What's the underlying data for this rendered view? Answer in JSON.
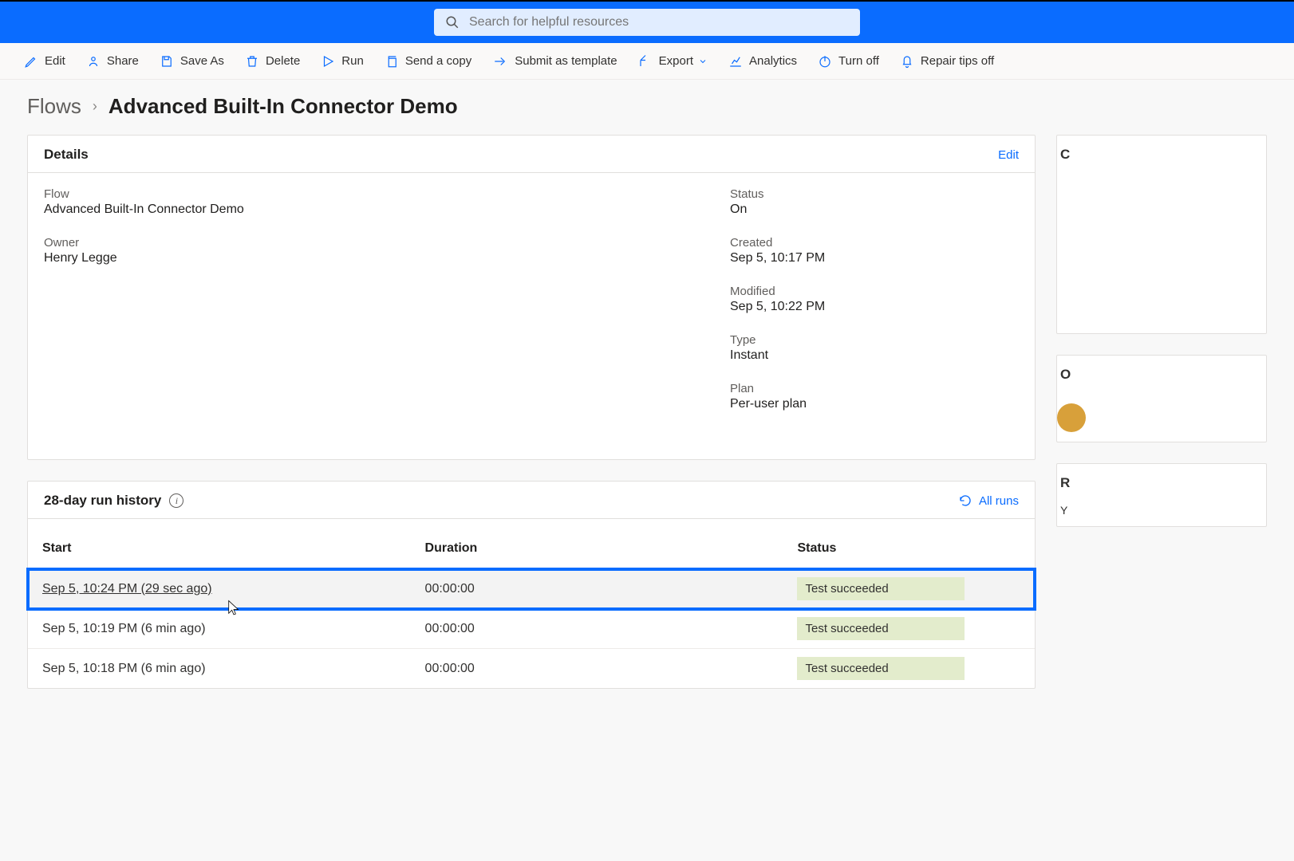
{
  "search": {
    "placeholder": "Search for helpful resources"
  },
  "toolbar": {
    "edit": "Edit",
    "share": "Share",
    "save_as": "Save As",
    "delete": "Delete",
    "run": "Run",
    "send_copy": "Send a copy",
    "submit_template": "Submit as template",
    "export": "Export",
    "analytics": "Analytics",
    "turn_off": "Turn off",
    "repair_tips": "Repair tips off"
  },
  "breadcrumb": {
    "root": "Flows",
    "title": "Advanced Built-In Connector Demo"
  },
  "details": {
    "header": "Details",
    "edit_link": "Edit",
    "flow_label": "Flow",
    "flow_value": "Advanced Built-In Connector Demo",
    "owner_label": "Owner",
    "owner_value": "Henry Legge",
    "status_label": "Status",
    "status_value": "On",
    "created_label": "Created",
    "created_value": "Sep 5, 10:17 PM",
    "modified_label": "Modified",
    "modified_value": "Sep 5, 10:22 PM",
    "type_label": "Type",
    "type_value": "Instant",
    "plan_label": "Plan",
    "plan_value": "Per-user plan"
  },
  "run_history": {
    "header": "28-day run history",
    "all_runs": "All runs",
    "columns": {
      "start": "Start",
      "duration": "Duration",
      "status": "Status"
    },
    "rows": [
      {
        "start": "Sep 5, 10:24 PM (29 sec ago)",
        "duration": "00:00:00",
        "status": "Test succeeded",
        "highlight": true
      },
      {
        "start": "Sep 5, 10:19 PM (6 min ago)",
        "duration": "00:00:00",
        "status": "Test succeeded",
        "highlight": false
      },
      {
        "start": "Sep 5, 10:18 PM (6 min ago)",
        "duration": "00:00:00",
        "status": "Test succeeded",
        "highlight": false
      }
    ]
  },
  "side": {
    "c1": "C",
    "o1": "O",
    "r1": "R",
    "y1": "Y"
  }
}
